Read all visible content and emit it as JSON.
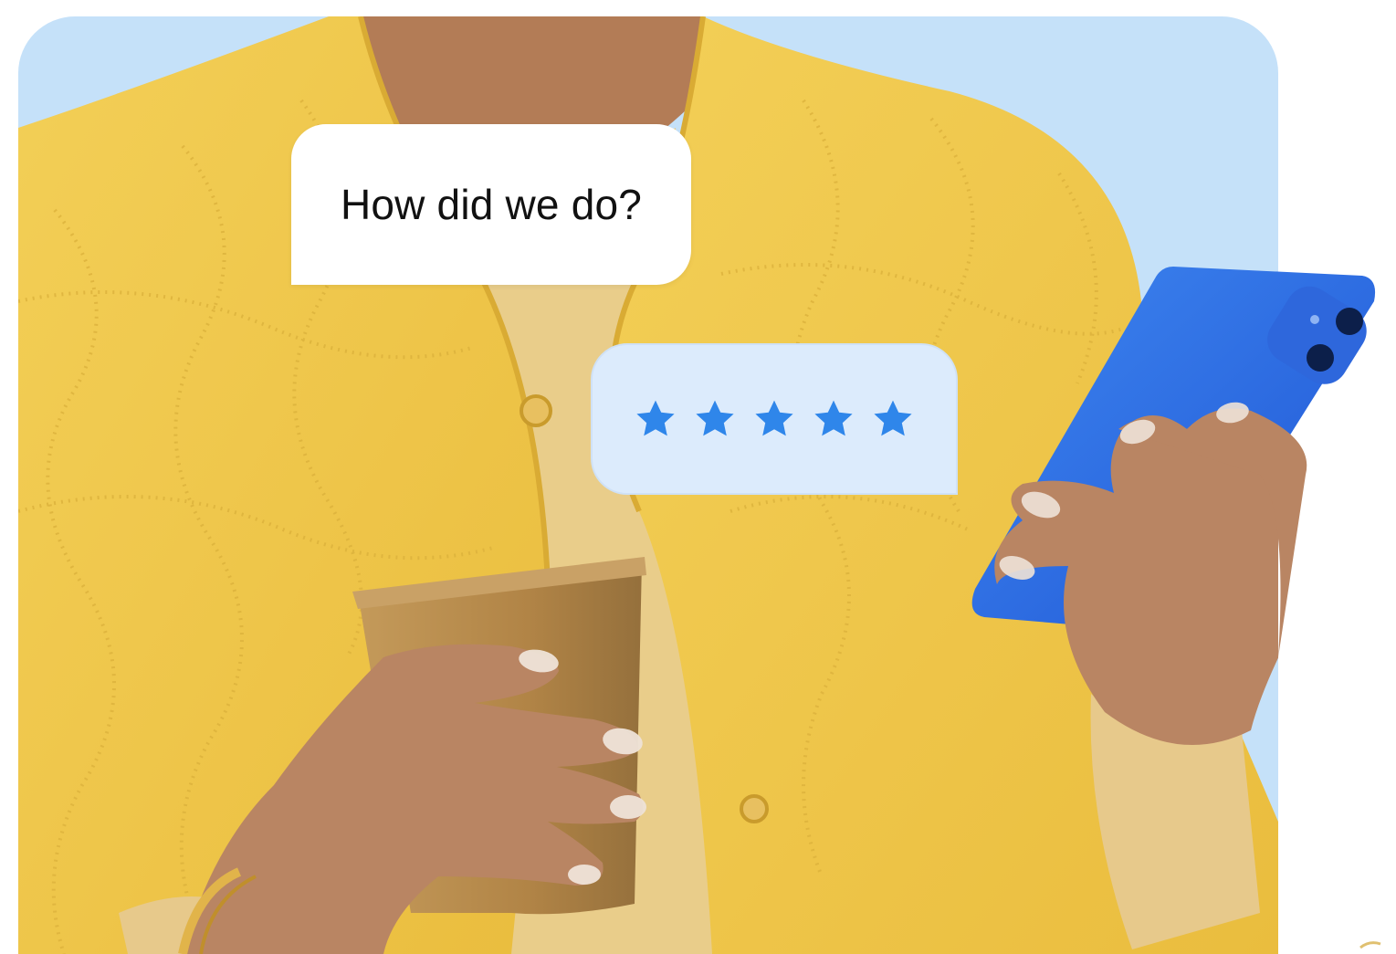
{
  "bubbles": {
    "question": "How did we do?",
    "rating": {
      "stars_filled": 5,
      "stars_total": 5,
      "star_icon": "star-icon",
      "star_color": "#2f86ea"
    }
  },
  "colors": {
    "card_background": "#c5e1f9",
    "jacket": "#f1c94e",
    "phone": "#2f6fe4",
    "cup": "#b48a4e",
    "skin": "#b98563",
    "rating_bubble_background": "#dcebfc"
  }
}
